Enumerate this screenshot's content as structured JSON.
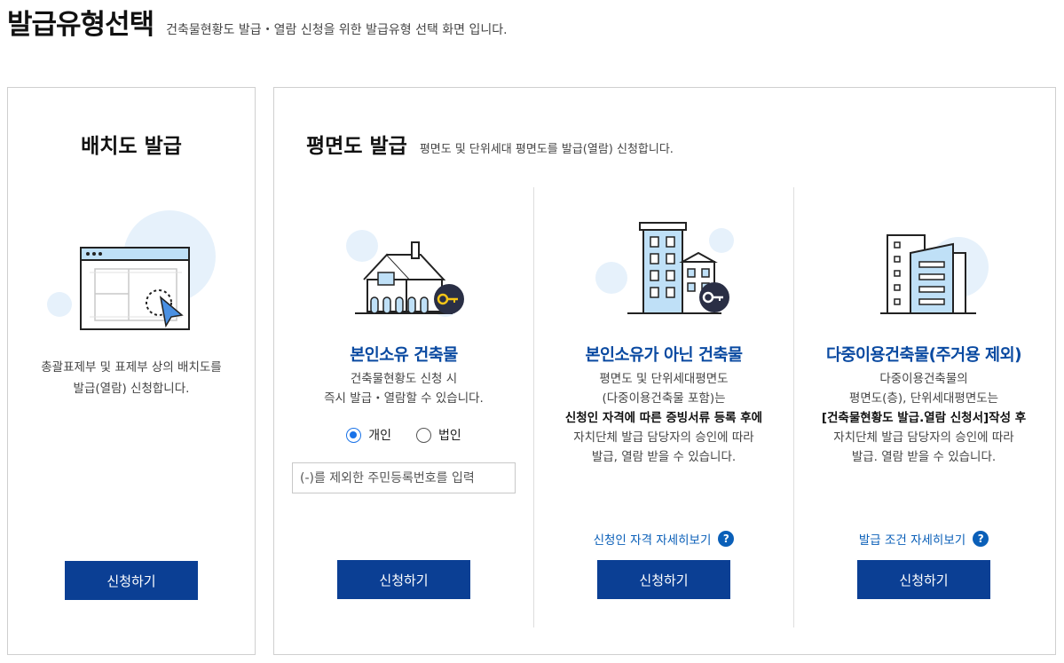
{
  "header": {
    "title": "발급유형선택",
    "subtitle": "건축물현황도 발급・열람 신청을 위한 발급유형 선택 화면 입니다."
  },
  "left_panel": {
    "title": "배치도 발급",
    "desc_line1": "총괄표제부 및 표제부 상의 배치도를",
    "desc_line2": "발급(열람) 신청합니다.",
    "button": "신청하기",
    "icon": "blueprint-window-icon"
  },
  "right_panel": {
    "title": "평면도 발급",
    "subtitle": "평면도 및 단위세대 평면도를 발급(열람) 신청합니다.",
    "columns": [
      {
        "title": "본인소유 건축물",
        "lines": [
          "건축물현황도 신청 시",
          "즉시 발급・열람할 수 있습니다."
        ],
        "radio_individual": "개인",
        "radio_corporate": "법인",
        "selected": "개인",
        "input_placeholder": "(-)를 제외한 주민등록번호를 입력",
        "button": "신청하기",
        "icon": "house-key-icon"
      },
      {
        "title": "본인소유가 아닌 건축물",
        "lines": [
          "평면도 및 단위세대평면도",
          "(다중이용건축물 포함)는",
          "신청인 자격에 따른 증빙서류 등록 후에",
          "자치단체 발급 담당자의 승인에 따라",
          "발급, 열람 받을 수 있습니다."
        ],
        "link": "신청인 자격 자세히보기",
        "button": "신청하기",
        "icon": "buildings-key-icon"
      },
      {
        "title": "다중이용건축물(주거용 제외)",
        "lines": [
          "다중이용건축물의",
          "평면도(층), 단위세대평면도는",
          "[건축물현황도 발급.열람 신청서]작성 후",
          "자치단체 발급 담당자의 승인에 따라",
          "발급. 열람 받을 수 있습니다."
        ],
        "link": "발급 조건 자세히보기",
        "button": "신청하기",
        "icon": "office-buildings-icon"
      }
    ]
  },
  "help_icon_glyph": "?",
  "colors": {
    "primary_button": "#0b3f94",
    "title_blue": "#0a4aa1",
    "link_blue": "#0a5fb8",
    "accent_light": "#e6f1fb"
  }
}
